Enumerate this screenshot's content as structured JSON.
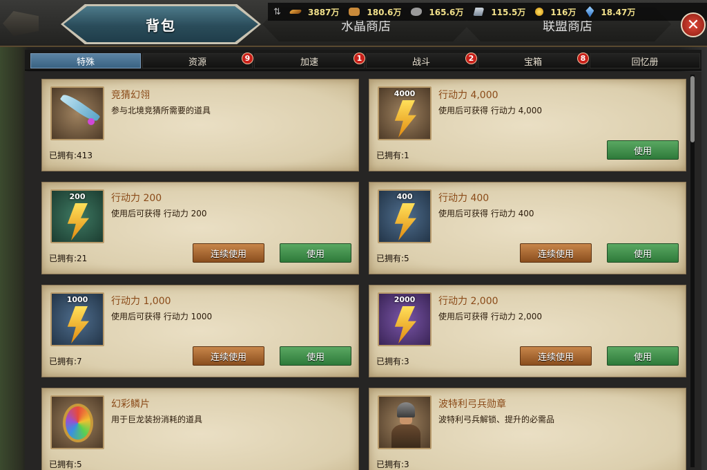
{
  "header": {
    "main_tab": "背包",
    "crystal_shop": "水晶商店",
    "alliance_shop": "联盟商店",
    "close_label": "✕"
  },
  "resources": {
    "sort_label": "⇅",
    "items": [
      {
        "icon": "wood-icon",
        "value": "3887万"
      },
      {
        "icon": "food-icon",
        "value": "180.6万"
      },
      {
        "icon": "stone-icon",
        "value": "165.6万"
      },
      {
        "icon": "iron-icon",
        "value": "115.5万"
      },
      {
        "icon": "gold-icon",
        "value": "116万"
      },
      {
        "icon": "crystal-icon",
        "value": "18.47万"
      }
    ]
  },
  "categories": [
    {
      "label": "特殊",
      "active": true
    },
    {
      "label": "资源",
      "badge": "9"
    },
    {
      "label": "加速",
      "badge": "1"
    },
    {
      "label": "战斗",
      "badge": "2"
    },
    {
      "label": "宝箱",
      "badge": "8"
    },
    {
      "label": "回忆册"
    }
  ],
  "buttons": {
    "use": "使用",
    "continuous_use": "连续使用"
  },
  "items": [
    {
      "name": "竞猜幻翎",
      "desc": "参与北境竞猜所需要的道具",
      "owned": "已拥有:413",
      "icon": "feather-icon"
    },
    {
      "name": "行动力 4,000",
      "desc": "使用后可获得 行动力 4,000",
      "owned": "已拥有:1",
      "badge": "4000",
      "icon": "lightning-icon"
    },
    {
      "name": "行动力 200",
      "desc": "使用后可获得 行动力 200",
      "owned": "已拥有:21",
      "badge": "200",
      "icon": "lightning-icon"
    },
    {
      "name": "行动力 400",
      "desc": "使用后可获得 行动力 400",
      "owned": "已拥有:5",
      "badge": "400",
      "icon": "lightning-icon"
    },
    {
      "name": "行动力 1,000",
      "desc": "使用后可获得 行动力 1000",
      "owned": "已拥有:7",
      "badge": "1000",
      "icon": "lightning-icon"
    },
    {
      "name": "行动力 2,000",
      "desc": "使用后可获得 行动力 2,000",
      "owned": "已拥有:3",
      "badge": "2000",
      "icon": "lightning-icon"
    },
    {
      "name": "幻彩鳞片",
      "desc": "用于巨龙装扮消耗的道具",
      "owned": "已拥有:5",
      "icon": "dragon-scale-icon"
    },
    {
      "name": "波特利弓兵勋章",
      "desc": "波特利弓兵解锁、提升的必需品",
      "owned": "已拥有:3",
      "icon": "archer-medal-icon"
    }
  ]
}
